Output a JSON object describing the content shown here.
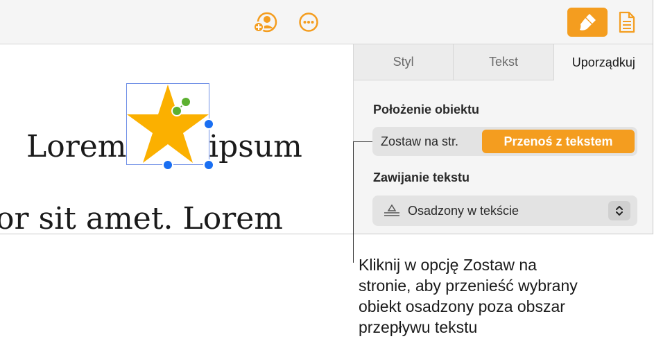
{
  "toolbar": {
    "icons": [
      "collaborate-icon",
      "more-icon",
      "format-brush-icon",
      "document-icon"
    ],
    "accent_color": "#f49d1f"
  },
  "document": {
    "word_left": "Lorem",
    "word_right": "ipsum",
    "line2": "or sit amet. Lorem",
    "shape": "star",
    "shape_color": "#fbb000"
  },
  "panel": {
    "tabs": [
      {
        "label": "Styl",
        "active": false
      },
      {
        "label": "Tekst",
        "active": false
      },
      {
        "label": "Uporządkuj",
        "active": true
      }
    ],
    "position_title": "Położenie obiektu",
    "segment_left": "Zostaw na str.",
    "segment_right": "Przenoś z tekstem",
    "wrap_title": "Zawijanie tekstu",
    "wrap_value": "Osadzony w tekście"
  },
  "callout": {
    "text": "Kliknij w opcję Zostaw na\nstronie, aby przenieść wybrany\nobiekt osadzony poza obszar\nprzepływu tekstu"
  }
}
